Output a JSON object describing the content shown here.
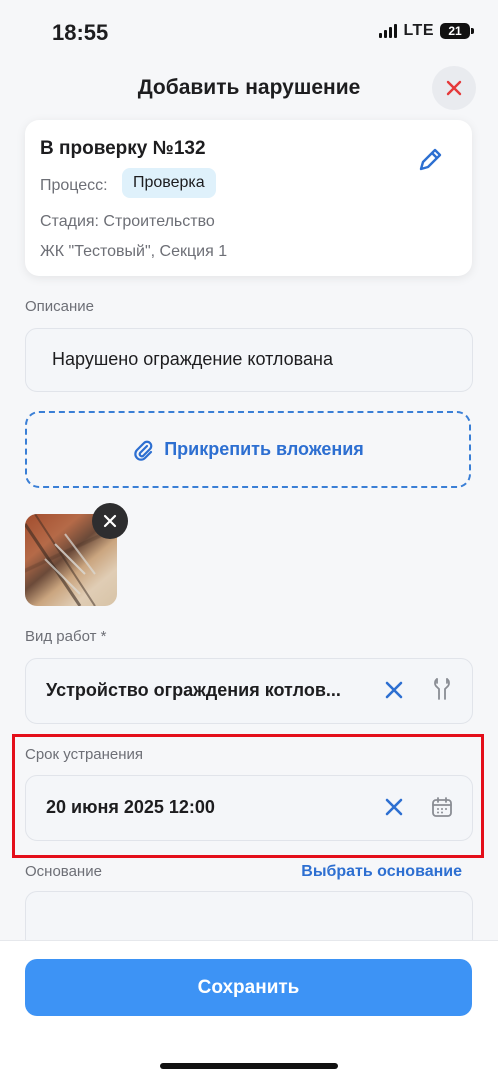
{
  "status_bar": {
    "time": "18:55",
    "network": "LTE",
    "battery": "21"
  },
  "header": {
    "title": "Добавить нарушение",
    "close_icon": "close-icon"
  },
  "card": {
    "title": "В проверку №132",
    "process_label": "Процесс:",
    "process_value": "Проверка",
    "stage": "Стадия: Строительство",
    "object": "ЖК \"Тестовый\", Секция 1"
  },
  "description": {
    "label": "Описание",
    "value": "Нарушено ограждение котлована"
  },
  "attachments": {
    "button_label": "Прикрепить вложения",
    "icon": "paperclip-icon"
  },
  "work_type": {
    "label": "Вид работ *",
    "value": "Устройство ограждения котлов..."
  },
  "deadline": {
    "label": "Срок устранения",
    "value": "20 июня 2025 12:00"
  },
  "basis": {
    "label": "Основание",
    "link": "Выбрать основание",
    "value": ""
  },
  "footer": {
    "save_label": "Сохранить"
  },
  "colors": {
    "accent": "#3d93f5",
    "link": "#2d6fd1",
    "close_red": "#e5393a",
    "highlight": "#e40e1a"
  }
}
